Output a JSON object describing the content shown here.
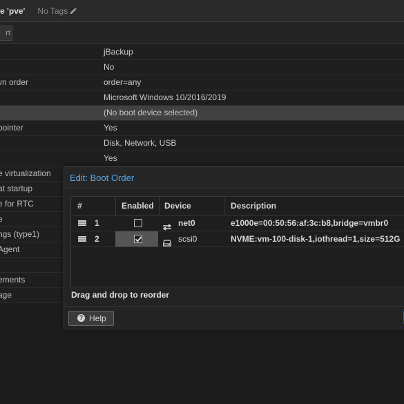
{
  "header": {
    "title": "e 'pve'",
    "tags_label": "No Tags",
    "tags_icon": "pencil-icon"
  },
  "toolbar": {
    "button_label": "rt"
  },
  "options": [
    {
      "key": "",
      "value": "jBackup"
    },
    {
      "key": "",
      "value": "No"
    },
    {
      "key": "vn order",
      "value": "order=any"
    },
    {
      "key": "",
      "value": "Microsoft Windows 10/2016/2019"
    },
    {
      "key": "",
      "value": "(No boot device selected)",
      "selected": true
    },
    {
      "key": "pointer",
      "value": "Yes"
    },
    {
      "key": "",
      "value": "Disk, Network, USB"
    },
    {
      "key": "",
      "value": "Yes"
    },
    {
      "key": "e virtualization",
      "value": ""
    },
    {
      "key": "at startup",
      "value": ""
    },
    {
      "key": "e for RTC",
      "value": ""
    },
    {
      "key": "e",
      "value": ""
    },
    {
      "key": "ngs (type1)",
      "value": ""
    },
    {
      "key": "Agent",
      "value": ""
    },
    {
      "key": "",
      "value": ""
    },
    {
      "key": "ements",
      "value": ""
    },
    {
      "key": "age",
      "value": ""
    }
  ],
  "dialog": {
    "title": "Edit: Boot Order",
    "columns": [
      "#",
      "Enabled",
      "Device",
      "Description"
    ],
    "rows": [
      {
        "num": "1",
        "enabled": false,
        "device_icon": "network-icon",
        "device": "net0",
        "description": "e1000e=00:50:56:af:3c:b8,bridge=vmbr0"
      },
      {
        "num": "2",
        "enabled": true,
        "device_icon": "disk-icon",
        "device": "scsi0",
        "description": "NVME:vm-100-disk-1,iothread=1,size=512G"
      }
    ],
    "hint": "Drag and drop to reorder",
    "help_label": "Help"
  },
  "colors": {
    "accent": "#5aa8e8",
    "background": "#1d1d1d"
  }
}
